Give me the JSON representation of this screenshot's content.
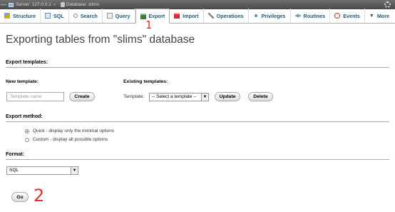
{
  "breadcrumb": {
    "server": "Server: 127.0.0.1",
    "separator": "»",
    "database": "Database: slims"
  },
  "tabs": [
    {
      "id": "structure",
      "label": "Structure",
      "icon": "structure-icon"
    },
    {
      "id": "sql",
      "label": "SQL",
      "icon": "sql-icon"
    },
    {
      "id": "search",
      "label": "Search",
      "icon": "search-icon"
    },
    {
      "id": "query",
      "label": "Query",
      "icon": "query-icon"
    },
    {
      "id": "export",
      "label": "Export",
      "icon": "export-icon",
      "active": true
    },
    {
      "id": "import",
      "label": "Import",
      "icon": "import-icon"
    },
    {
      "id": "operations",
      "label": "Operations",
      "icon": "operations-icon"
    },
    {
      "id": "privileges",
      "label": "Privileges",
      "icon": "privileges-icon"
    },
    {
      "id": "routines",
      "label": "Routines",
      "icon": "routines-icon"
    },
    {
      "id": "events",
      "label": "Events",
      "icon": "events-icon"
    },
    {
      "id": "more",
      "label": "More",
      "icon": "caret-down-icon"
    }
  ],
  "annotations": {
    "one": "1",
    "two": "2"
  },
  "page_title": "Exporting tables from \"slims\" database",
  "export_templates": {
    "heading": "Export templates:",
    "new_template_label": "New template:",
    "template_name_placeholder": "Template name",
    "create_label": "Create",
    "existing_templates_label": "Existing templates:",
    "template_label": "Template:",
    "select_value": "-- Select a template --",
    "update_label": "Update",
    "delete_label": "Delete"
  },
  "export_method": {
    "heading": "Export method:",
    "options": [
      {
        "label": "Quick - display only the minimal options",
        "checked": true
      },
      {
        "label": "Custom - display all possible options",
        "checked": false
      }
    ]
  },
  "format": {
    "heading": "Format:",
    "selected": "SQL"
  },
  "go_label": "Go",
  "colors": {
    "annotation": "#e0302b",
    "tab_text": "#235a81"
  }
}
